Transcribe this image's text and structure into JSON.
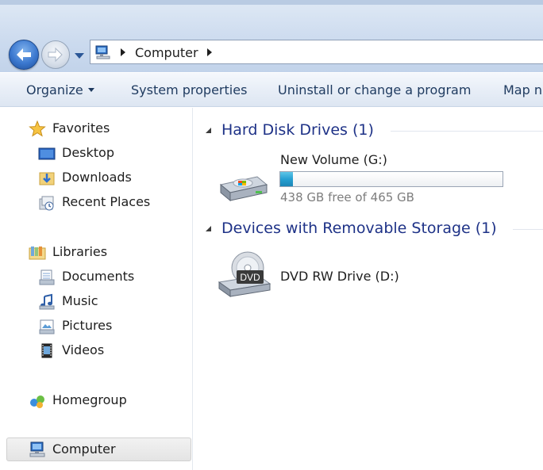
{
  "address_bar": {
    "breadcrumb": [
      "Computer"
    ]
  },
  "toolbar": {
    "organize_label": "Organize",
    "system_properties_label": "System properties",
    "uninstall_label": "Uninstall or change a program",
    "map_label": "Map n"
  },
  "navigation_pane": {
    "favorites": {
      "label": "Favorites",
      "items": [
        "Desktop",
        "Downloads",
        "Recent Places"
      ]
    },
    "libraries": {
      "label": "Libraries",
      "items": [
        "Documents",
        "Music",
        "Pictures",
        "Videos"
      ]
    },
    "homegroup": {
      "label": "Homegroup"
    },
    "computer": {
      "label": "Computer",
      "selected": true
    }
  },
  "content": {
    "groups": [
      {
        "title": "Hard Disk Drives (1)",
        "items": [
          {
            "name": "New Volume (G:)",
            "free_text": "438 GB free of 465 GB",
            "used_fraction": 0.058,
            "icon": "hard-drive-icon"
          }
        ]
      },
      {
        "title": "Devices with Removable Storage (1)",
        "items": [
          {
            "name": "DVD RW Drive (D:)",
            "icon": "dvd-drive-icon",
            "icon_text": "DVD"
          }
        ]
      }
    ]
  },
  "colors": {
    "group_title": "#1e3287",
    "meter_fill": "#26a0d2",
    "toolbar_text": "#1e3a5f"
  }
}
